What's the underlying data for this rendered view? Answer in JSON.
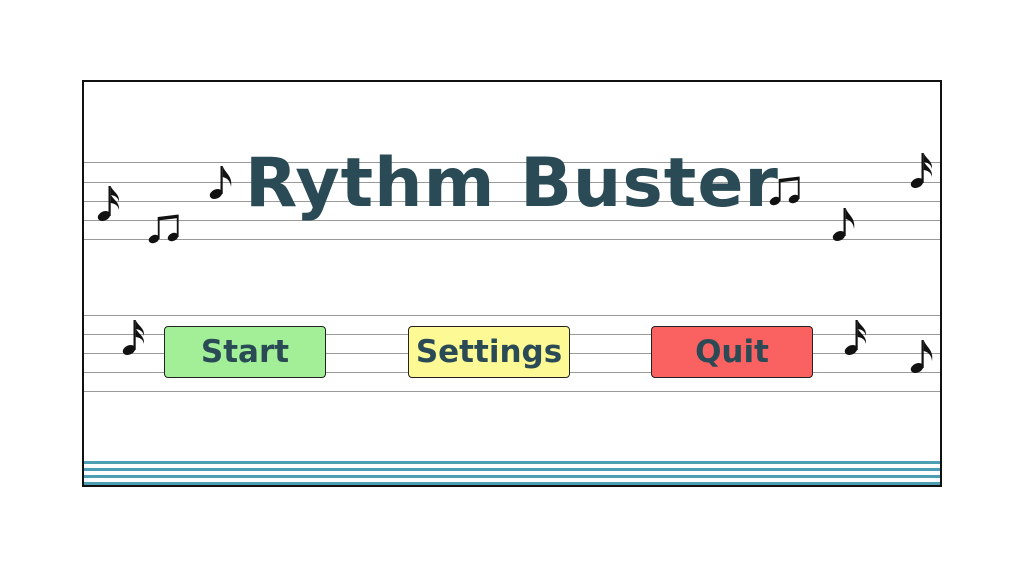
{
  "title": "Rythm Buster",
  "menu": {
    "start_label": "Start",
    "settings_label": "Settings",
    "quit_label": "Quit"
  },
  "colors": {
    "title": "#2a4a55",
    "start": "#a2ef98",
    "settings": "#fdfa96",
    "quit": "#fa6262",
    "staff_accent": "#4c9fb2"
  },
  "icons": [
    "sixteenth-note-icon",
    "beamed-eighth-notes-icon",
    "eighth-note-icon"
  ]
}
